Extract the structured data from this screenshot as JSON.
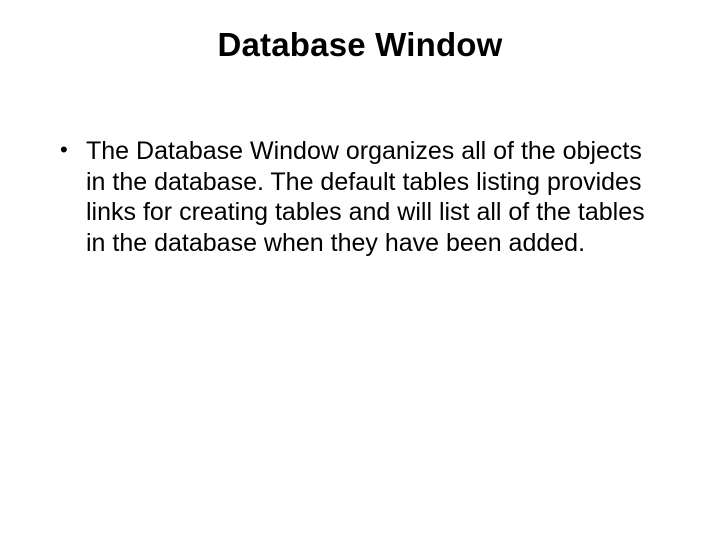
{
  "slide": {
    "title": "Database Window",
    "bullets": [
      "The Database Window organizes all of the objects in the database. The default tables listing provides links for creating tables and will list all of the tables in the database when they have been added."
    ]
  }
}
